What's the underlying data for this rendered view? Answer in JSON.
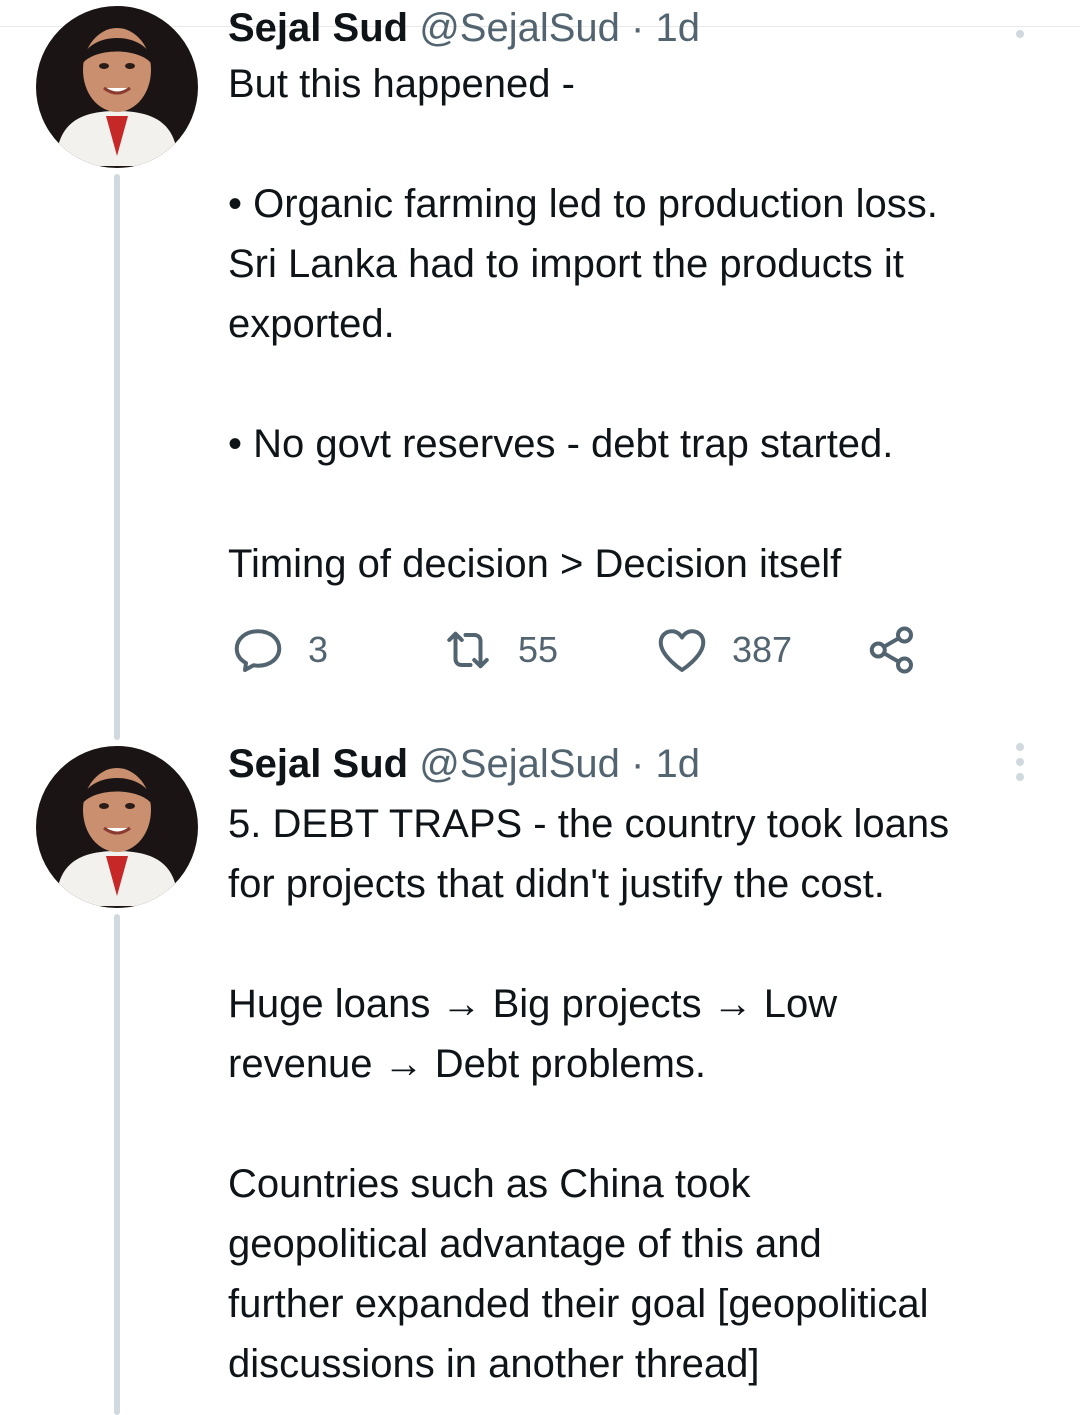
{
  "tweets": [
    {
      "author_name": "Sejal Sud",
      "handle": "@SejalSud",
      "separator": "·",
      "time": "1d",
      "lines": [
        "But this happened -",
        "",
        "• Organic farming led to production loss.",
        "Sri Lanka had to import the products it",
        "exported.",
        "",
        "• No govt reserves - debt trap started.",
        "",
        "Timing of decision > Decision itself"
      ],
      "actions": {
        "replies": "3",
        "retweets": "55",
        "likes": "387"
      }
    },
    {
      "author_name": "Sejal Sud",
      "handle": "@SejalSud",
      "separator": "·",
      "time": "1d",
      "lines": [
        "5. DEBT TRAPS - the country took loans",
        "for projects that didn't justify the cost.",
        "",
        "Huge loans → Big projects → Low",
        "revenue → Debt problems.",
        "",
        "Countries such as China took",
        "geopolitical advantage of this and",
        "further expanded their goal [geopolitical",
        "discussions in another thread]"
      ]
    }
  ],
  "colors": {
    "text": "#0f1419",
    "secondary": "#536471",
    "thread_line": "#cfd9de",
    "divider": "#e7e9ea"
  },
  "icons": {
    "reply": "reply-icon",
    "retweet": "retweet-icon",
    "like": "heart-icon",
    "share": "share-icon",
    "more": "more-vertical-icon"
  }
}
